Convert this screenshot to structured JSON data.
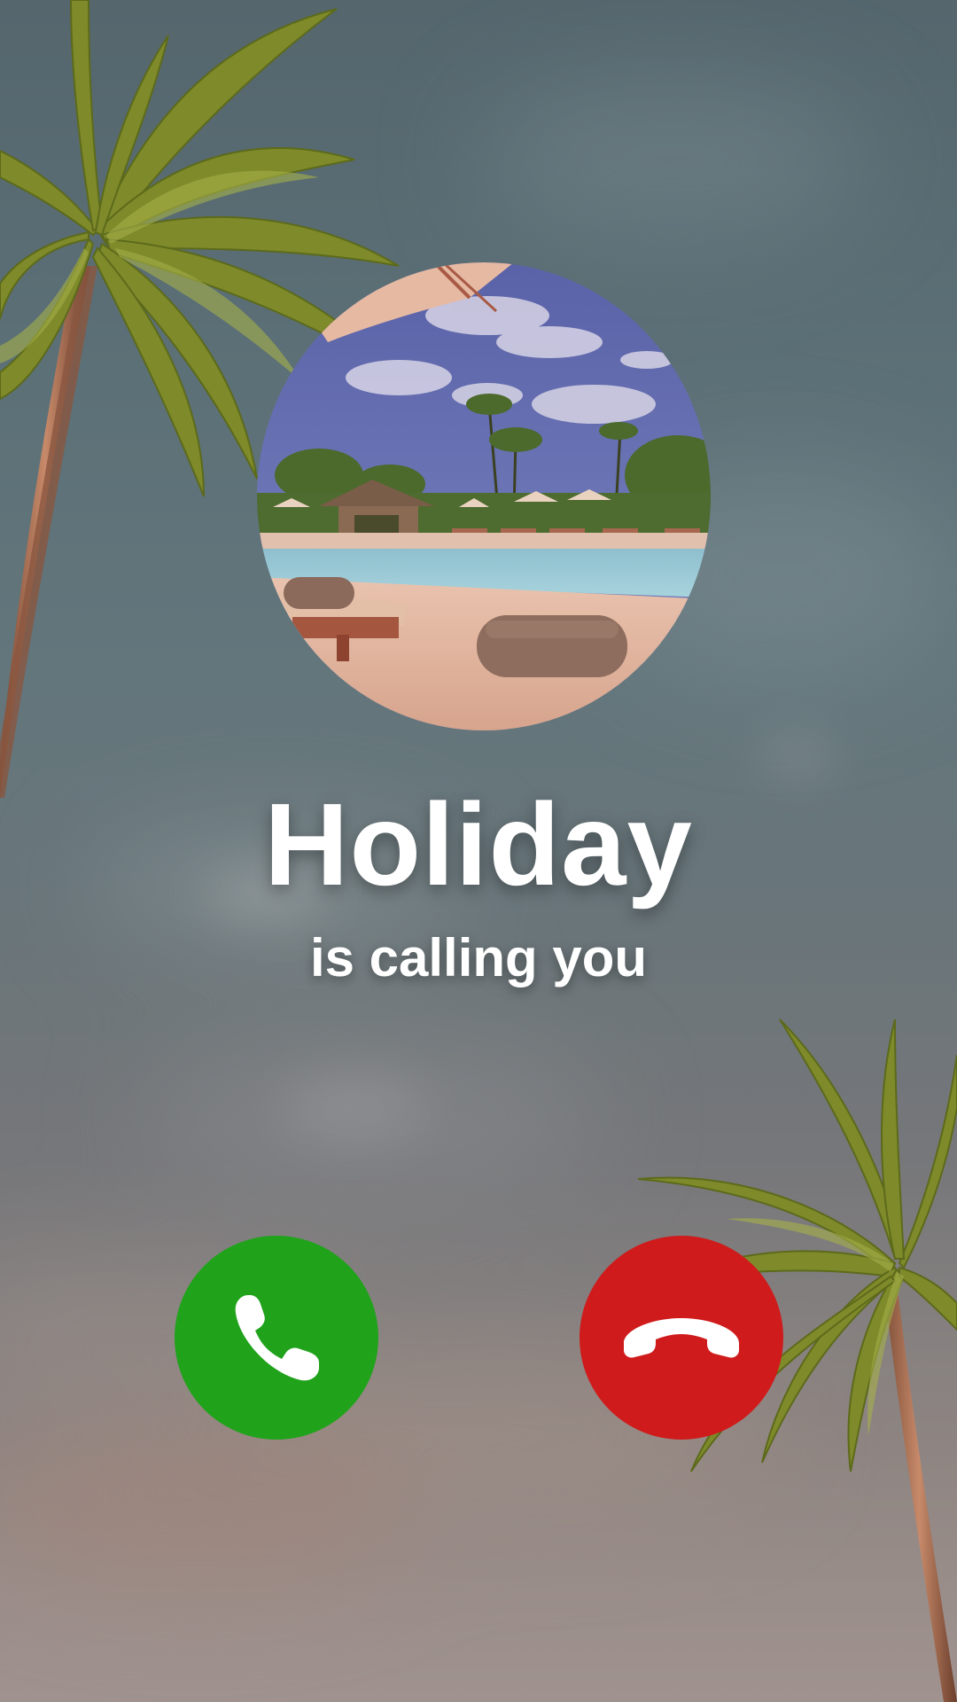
{
  "caller": {
    "name": "Holiday",
    "status": "is calling you"
  },
  "actions": {
    "accept": {
      "icon": "phone-accept-icon",
      "color": "#20a21b"
    },
    "decline": {
      "icon": "phone-hangup-icon",
      "color": "#cf1b1b"
    }
  },
  "palette": {
    "background_top": "#55666d",
    "background_bottom": "#a0938f",
    "text": "#ffffff"
  }
}
